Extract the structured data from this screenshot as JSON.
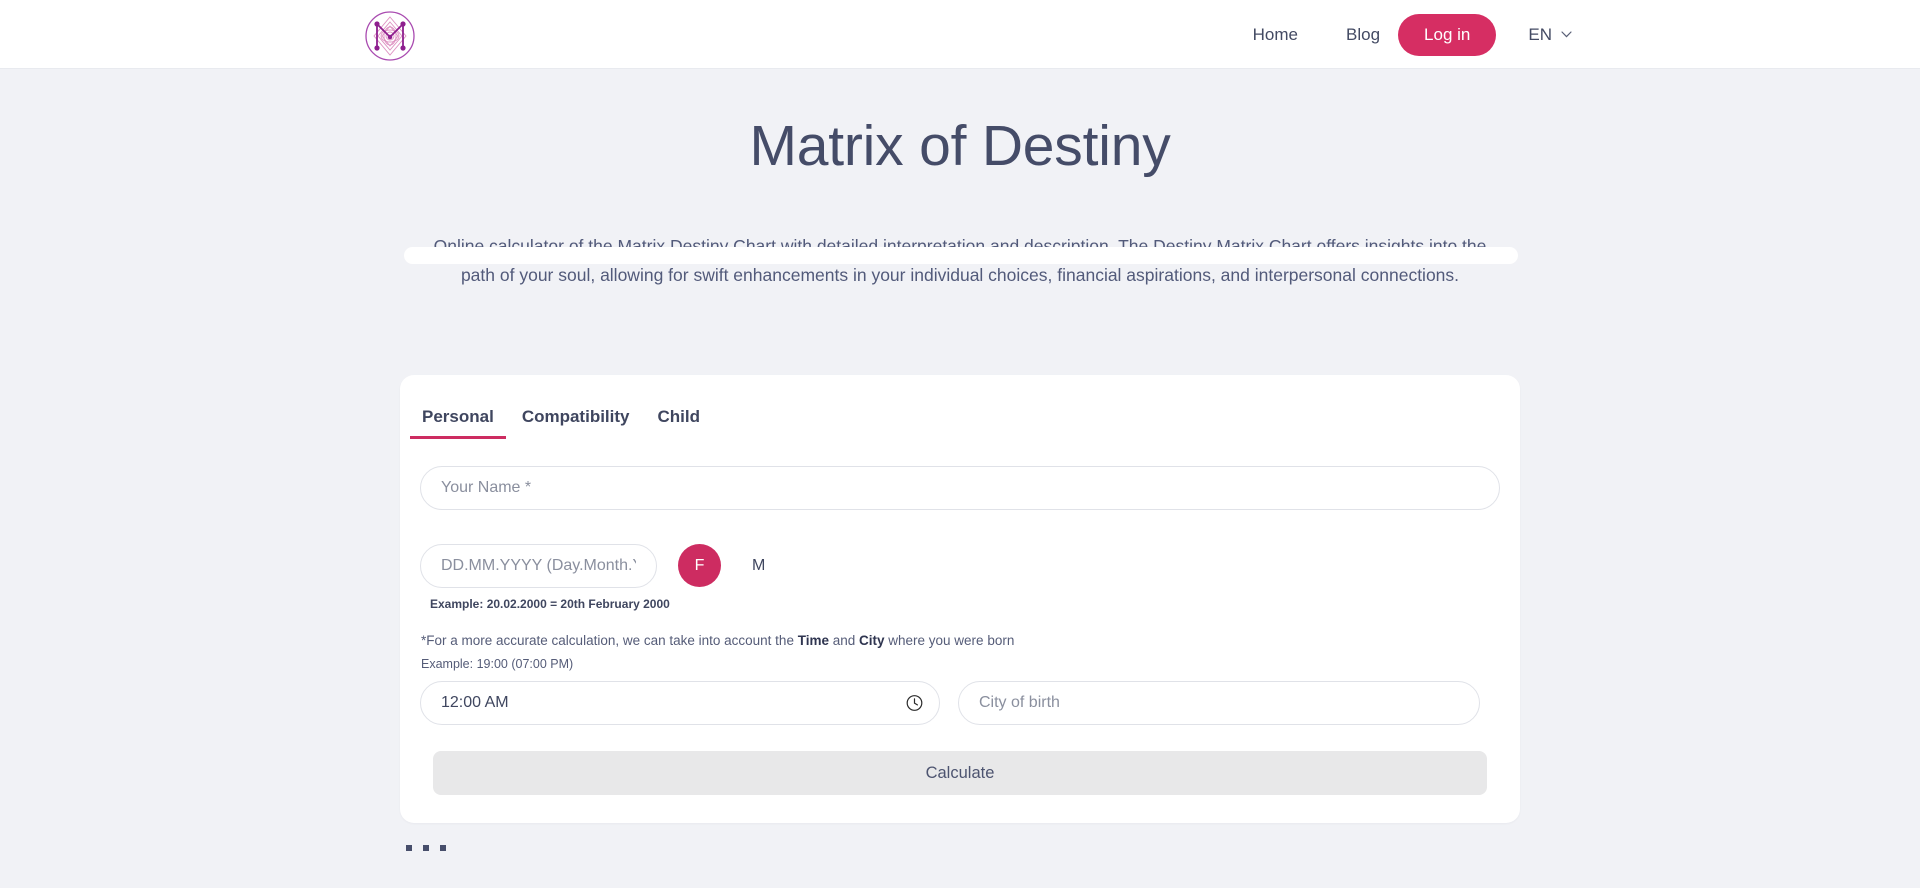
{
  "header": {
    "logo_alt": "matrix-logo",
    "nav": [
      {
        "label": "Home",
        "name": "nav-home"
      },
      {
        "label": "Blog",
        "name": "nav-blog"
      }
    ],
    "login_label": "Log in",
    "language": "EN",
    "accent_color": "#d62e63"
  },
  "hero": {
    "title": "Matrix of Destiny",
    "description": "Online calculator of the Matrix Destiny Chart with detailed interpretation and description. The Destiny Matrix Chart offers insights into the path of your soul, allowing for swift enhancements in your individual choices, financial aspirations, and interpersonal connections."
  },
  "form": {
    "tabs": [
      {
        "label": "Personal",
        "active": true
      },
      {
        "label": "Compatibility",
        "active": false
      },
      {
        "label": "Child",
        "active": false
      }
    ],
    "name_placeholder": "Your Name *",
    "dob_placeholder": "DD.MM.YYYY (Day.Month.Year)",
    "dob_hint": "Example: 20.02.2000 = 20th February 2000",
    "gender_female": "F",
    "gender_male": "M",
    "gender_selected": "F",
    "note_prefix": "*For a more accurate calculation, we can take into account the ",
    "note_bold_time": "Time",
    "note_mid": " and ",
    "note_bold_city": "City",
    "note_suffix": " where you were born",
    "time_example": "Example: 19:00 (07:00 PM)",
    "time_value": "12:00 AM",
    "city_placeholder": "City of birth",
    "calculate_label": "Calculate",
    "calculate_disabled": true,
    "active_tab_underline_color": "#cd2c61"
  },
  "footer": {
    "loading_dots": 3
  }
}
